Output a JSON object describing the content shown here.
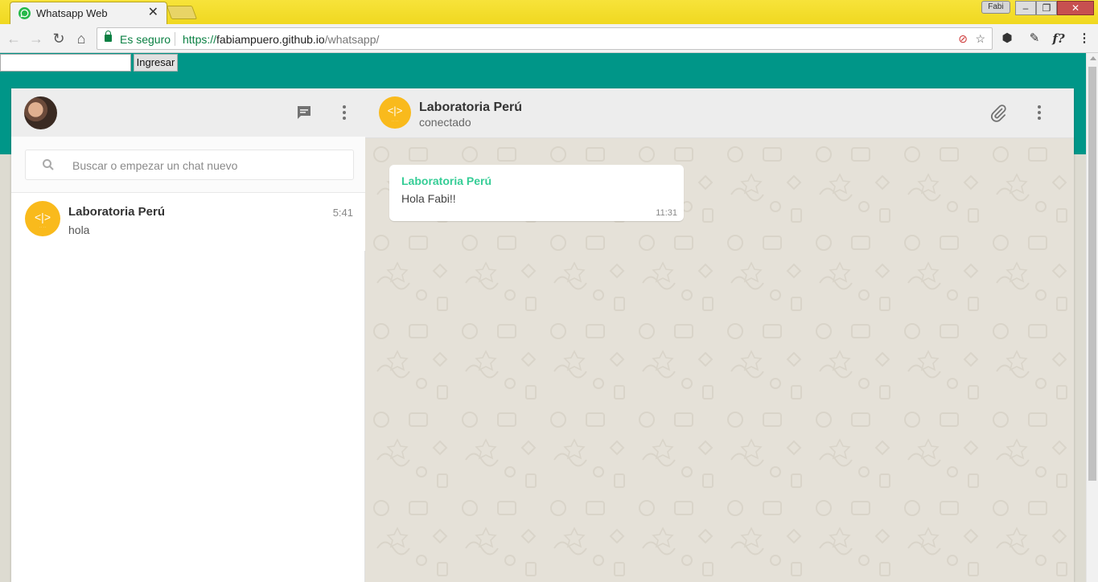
{
  "browser": {
    "tab_title": "Whatsapp Web",
    "tab_close": "✕",
    "profile_name": "Fabi",
    "secure_label": "Es seguro",
    "url_scheme": "https://",
    "url_host": "fabiampuero.github.io",
    "url_path": "/whatsapp/",
    "icons": [
      "back-icon",
      "forward-icon",
      "reload-icon",
      "home-icon",
      "lock-icon",
      "star-icon",
      "menu-icon"
    ]
  },
  "login": {
    "input_value": "",
    "button_label": "Ingresar"
  },
  "sidebar": {
    "search_placeholder": "Buscar o empezar un chat nuevo",
    "chats": [
      {
        "name": "Laboratoria Perú",
        "time": "5:41",
        "preview": "hola"
      }
    ]
  },
  "conversation": {
    "contact_name": "Laboratoria Perú",
    "contact_status": "conectado",
    "messages": [
      {
        "sender": "Laboratoria Perú",
        "text": "Hola Fabi!!",
        "time": "11:31"
      }
    ]
  },
  "avatar_text": "<|>",
  "colors": {
    "header_teal": "#009688",
    "lab_yellow": "#f9ba1c",
    "sender_green": "#35cd96",
    "secure_green": "#0b8043"
  }
}
